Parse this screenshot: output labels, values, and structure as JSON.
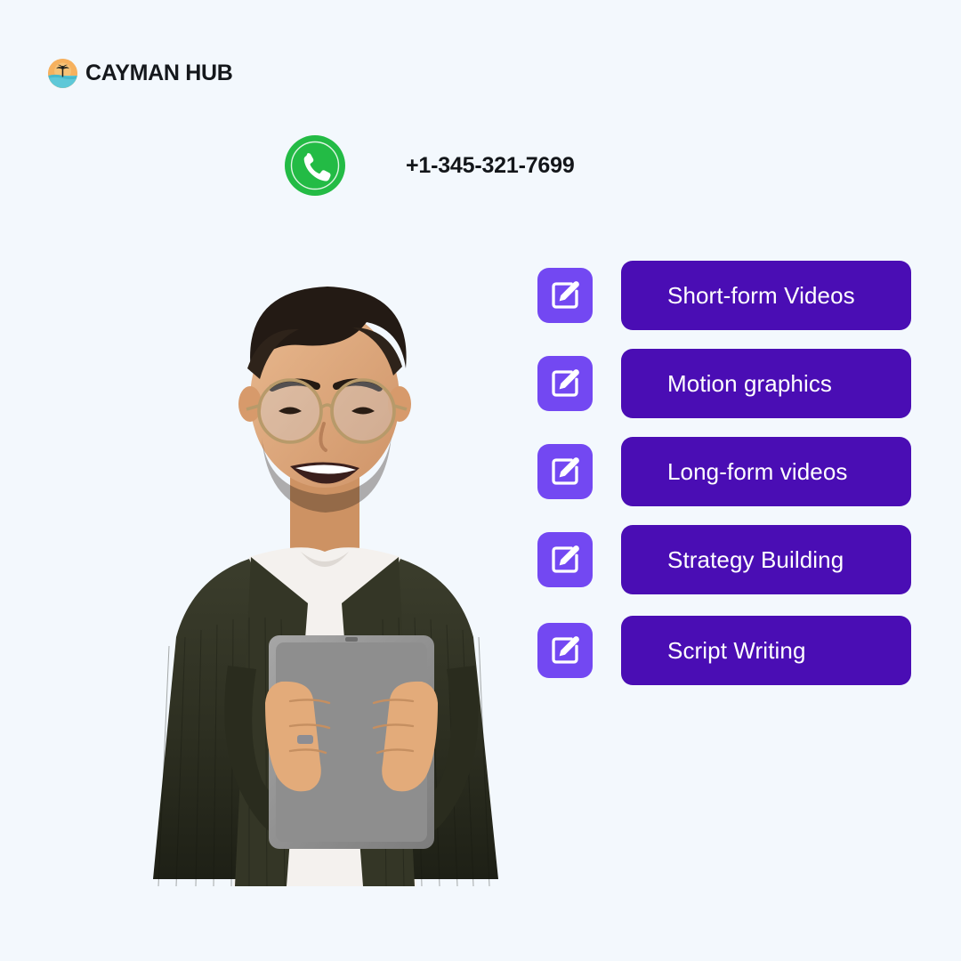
{
  "theme": {
    "background": "#f3f8fd",
    "pill_purple": "#4a0db4",
    "icon_purple": "#7348f2",
    "phone_green": "#23bb45",
    "text_dark": "#13161a",
    "text_on_pill": "#ffffff"
  },
  "brand": {
    "name": "CAYMAN HUB",
    "logo_icon": "beach-palm-sunset-circle-icon"
  },
  "contact": {
    "phone_icon": "phone-handset-icon",
    "phone_number": "+1-345-321-7699"
  },
  "hero": {
    "photo_alt": "smiling-young-man-with-glasses-holding-tablet",
    "photo_name": "hero-portrait-photo"
  },
  "services": {
    "item_icon": "edit-pencil-square-icon",
    "items": [
      {
        "label": "Short-form Videos"
      },
      {
        "label": "Motion graphics"
      },
      {
        "label": "Long-form videos"
      },
      {
        "label": "Strategy Building"
      },
      {
        "label": "Script Writing"
      }
    ]
  }
}
